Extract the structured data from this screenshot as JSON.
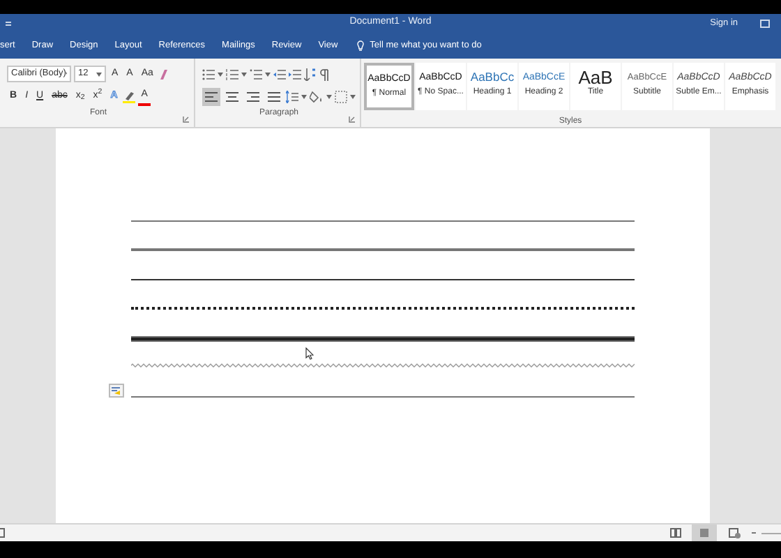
{
  "window": {
    "title": "Document1 - Word",
    "sign_in": "Sign in"
  },
  "tabs": [
    {
      "label": "sert",
      "selected": false
    },
    {
      "label": "Draw",
      "selected": false
    },
    {
      "label": "Design",
      "selected": false
    },
    {
      "label": "Layout",
      "selected": false
    },
    {
      "label": "References",
      "selected": false
    },
    {
      "label": "Mailings",
      "selected": false
    },
    {
      "label": "Review",
      "selected": false
    },
    {
      "label": "View",
      "selected": false
    }
  ],
  "tell_me": {
    "placeholder": "Tell me what you want to do"
  },
  "font_group": {
    "label": "Font",
    "font_name": "Calibri (Body)",
    "font_size": "12",
    "grow": "A",
    "shrink": "A",
    "change_case": "Aa",
    "format_buttons": [
      {
        "kind": "bold",
        "label": "B"
      },
      {
        "kind": "italic",
        "label": "I"
      },
      {
        "kind": "underline",
        "label": "U"
      },
      {
        "kind": "strike",
        "label": "abc"
      },
      {
        "kind": "plain",
        "label": "x$_{2}$"
      },
      {
        "kind": "plain",
        "label": "x$^{2}$"
      }
    ],
    "effects": "A",
    "font_color": "A"
  },
  "paragraph_group": {
    "label": "Paragraph",
    "alignment_buttons": [
      {
        "selected": true
      },
      {
        "selected": false
      },
      {
        "selected": false
      },
      {
        "selected": false
      }
    ]
  },
  "styles_group": {
    "label": "Styles",
    "styles": [
      {
        "kind": "normal",
        "preview": "AaBbCcD",
        "name": "¶ Normal",
        "selected": true
      },
      {
        "kind": "normal",
        "preview": "AaBbCcD",
        "name": "¶ No Spac...",
        "selected": false
      },
      {
        "kind": "heading1",
        "preview": "AaBbCc",
        "name": "Heading 1",
        "selected": false
      },
      {
        "kind": "heading2",
        "preview": "AaBbCcE",
        "name": "Heading 2",
        "selected": false
      },
      {
        "kind": "title",
        "preview": "AaB",
        "name": "Title",
        "selected": false
      },
      {
        "kind": "subtitle",
        "preview": "AaBbCcE",
        "name": "Subtitle",
        "selected": false
      },
      {
        "kind": "emphasis",
        "preview": "AaBbCcD",
        "name": "Subtle Em...",
        "selected": false
      },
      {
        "kind": "emphasis",
        "preview": "AaBbCcD",
        "name": "Emphasis",
        "selected": false
      }
    ]
  },
  "document": {
    "lines": [
      {
        "kind": "single"
      },
      {
        "kind": "thick"
      },
      {
        "kind": "medium"
      },
      {
        "kind": "dotted"
      },
      {
        "kind": "triple"
      },
      {
        "kind": "wavy"
      },
      {
        "kind": "single"
      }
    ]
  }
}
